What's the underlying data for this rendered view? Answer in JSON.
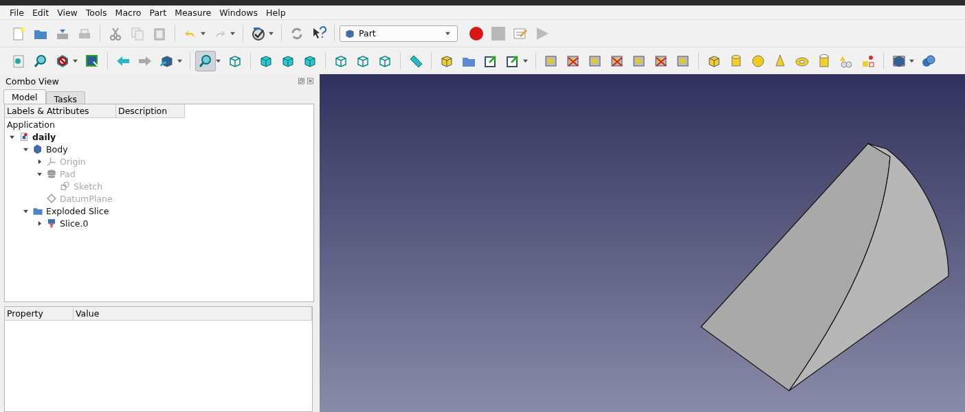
{
  "menu": [
    "File",
    "Edit",
    "View",
    "Tools",
    "Macro",
    "Part",
    "Measure",
    "Windows",
    "Help"
  ],
  "workbench": {
    "value": "Part"
  },
  "combo_view": {
    "title": "Combo View",
    "tabs": [
      {
        "label": "Model",
        "selected": true
      },
      {
        "label": "Tasks",
        "selected": false
      }
    ],
    "tree_columns": [
      "Labels & Attributes",
      "Description"
    ],
    "root": "Application",
    "tree": [
      {
        "label": "daily",
        "kind": "document",
        "disabled": false,
        "expanded": true,
        "children": [
          {
            "label": "Body",
            "kind": "body",
            "disabled": false,
            "expanded": true,
            "children": [
              {
                "label": "Origin",
                "kind": "origin",
                "disabled": true,
                "expanded": false
              },
              {
                "label": "Pad",
                "kind": "pad",
                "disabled": true,
                "expanded": true,
                "children": [
                  {
                    "label": "Sketch",
                    "kind": "sketch",
                    "disabled": true
                  }
                ]
              },
              {
                "label": "DatumPlane",
                "kind": "plane",
                "disabled": true
              }
            ]
          },
          {
            "label": "Exploded Slice",
            "kind": "folder",
            "disabled": false,
            "expanded": true,
            "children": [
              {
                "label": "Slice.0",
                "kind": "slice",
                "disabled": false,
                "expanded": false
              }
            ]
          }
        ]
      }
    ],
    "property_columns": [
      "Property",
      "Value"
    ]
  }
}
